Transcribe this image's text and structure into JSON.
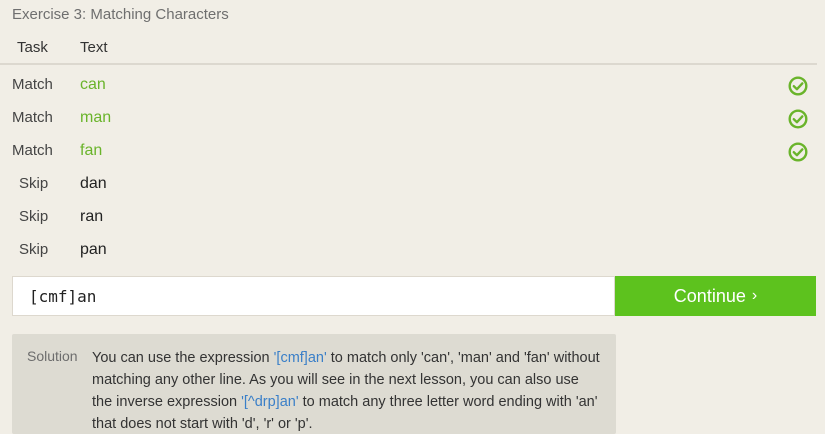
{
  "exercise": {
    "title": "Exercise 3: Matching Characters"
  },
  "table": {
    "headers": {
      "task": "Task",
      "text": "Text"
    },
    "rows": [
      {
        "task": "Match",
        "text": "can",
        "matched": true
      },
      {
        "task": "Match",
        "text": "man",
        "matched": true
      },
      {
        "task": "Match",
        "text": "fan",
        "matched": true
      },
      {
        "task": "Skip",
        "text": "dan",
        "matched": false
      },
      {
        "task": "Skip",
        "text": "ran",
        "matched": false
      },
      {
        "task": "Skip",
        "text": "pan",
        "matched": false
      }
    ]
  },
  "answer": {
    "value": "[cmf]an"
  },
  "continue_button": {
    "label": "Continue",
    "chevron": "›"
  },
  "solution": {
    "label": "Solution",
    "part1": "You can use the expression ",
    "code1": "'[cmf]an'",
    "part2": " to match only 'can', 'man' and 'fan' without matching any other line. As you will see in the next lesson, you can also use the inverse expression ",
    "code2": "'[^drp]an'",
    "part3": " to match any three letter word ending with 'an' that does not start with 'd', 'r' or 'p'."
  },
  "colors": {
    "background": "#f1eee6",
    "match_green": "#6ab42b",
    "button_green": "#5dc21e",
    "code_blue": "#3a7fc8",
    "solution_bg": "#dddbd2"
  },
  "icons": {
    "check": "check-circle-icon"
  }
}
